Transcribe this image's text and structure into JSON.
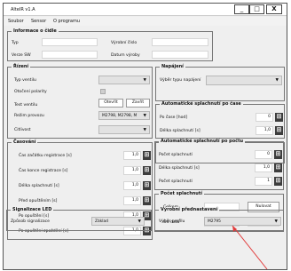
{
  "window": {
    "title": "AlteIR v1.A",
    "btn_min": "_",
    "btn_max": "□",
    "btn_close": "X"
  },
  "menu": [
    "Soubor",
    "Sensor",
    "O programu"
  ],
  "info": {
    "title": "Informace o čidle",
    "typ": "Typ",
    "verze": "Verze SW",
    "vyr_cislo": "Výrobní číslo",
    "datum": "Datum výroby"
  },
  "rizeni": {
    "title": "Řízení",
    "typ_ventilu": "Typ ventilu",
    "otoceni": "Otočení polarity",
    "test": "Test ventilu",
    "otevrit": "Otevřít",
    "zavrit": "Zavřít",
    "rezim": "Režim provozu",
    "rezim_value": "M2798, M2798, M",
    "citlivost": "Citlivost"
  },
  "napajeni": {
    "title": "Napájení",
    "vyber": "Výběr typu napájení"
  },
  "auto_cas": {
    "title": "Automatické splachnutí po čase",
    "po_case": "Po čase [hod]",
    "po_case_val": "0",
    "delka": "Délka splachnutí [s]",
    "delka_val": "1,0"
  },
  "casovani": {
    "title": "Časování",
    "rows": [
      {
        "label": "Čas začátku registrace [s]",
        "value": "1,0"
      },
      {
        "label": "Čas konce registrace [s]",
        "value": "1,0"
      },
      {
        "label": "Délka splachnutí [s]",
        "value": "1,0"
      },
      {
        "label": "Před opuštěním [s]",
        "value": "1,0"
      },
      {
        "label": "Po opuštění [s]",
        "value": "1,0"
      },
      {
        "label": "Po opuštění zpoždění [s]",
        "value": "1,0"
      }
    ]
  },
  "auto_pocet": {
    "title": "Automatické splachnutí po počtu",
    "pocet": "Počet splachnutí",
    "pocet_val": "0",
    "delka": "Délka splachnutí [s]",
    "delka_val": "1,0",
    "splachnuti": "Počet splachnutí",
    "splachnuti_val": "1"
  },
  "pocet": {
    "title": "Počet splachnutí",
    "celkem": "Celkem",
    "nulovat": "Nulovat",
    "od_data": "Od data"
  },
  "led": {
    "title": "Signalizace LED",
    "zpusob": "Způsob signalizace",
    "value": "Základ"
  },
  "vyrobni": {
    "title": "Výrobní přednastavení",
    "vyber": "Výběr profilu",
    "value": "M2795"
  },
  "accent": "#e23a3a"
}
